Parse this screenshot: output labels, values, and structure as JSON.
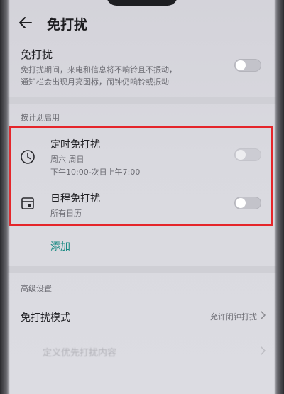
{
  "header": {
    "title": "免打扰"
  },
  "master": {
    "title": "免打扰",
    "desc_line1": "免打扰期间，来电和信息将不响铃且不振动，",
    "desc_line2": "通知栏会出现月亮图标，闹钟仍响铃或振动",
    "enabled": false
  },
  "schedule": {
    "section_label": "按计划启用",
    "timed": {
      "title": "定时免打扰",
      "days": "周六 周日",
      "time_range": "下午10:00-次日上午7:00",
      "enabled": false
    },
    "calendar": {
      "title": "日程免打扰",
      "sub": "所有日历",
      "enabled": false
    },
    "add_label": "添加"
  },
  "advanced": {
    "section_label": "高级设置",
    "mode_title": "免打扰模式",
    "mode_value": "允许闹钟打扰",
    "custom_title": "定义优先打扰内容"
  },
  "colors": {
    "accent": "#1a8a83",
    "highlight": "#e5252a"
  }
}
